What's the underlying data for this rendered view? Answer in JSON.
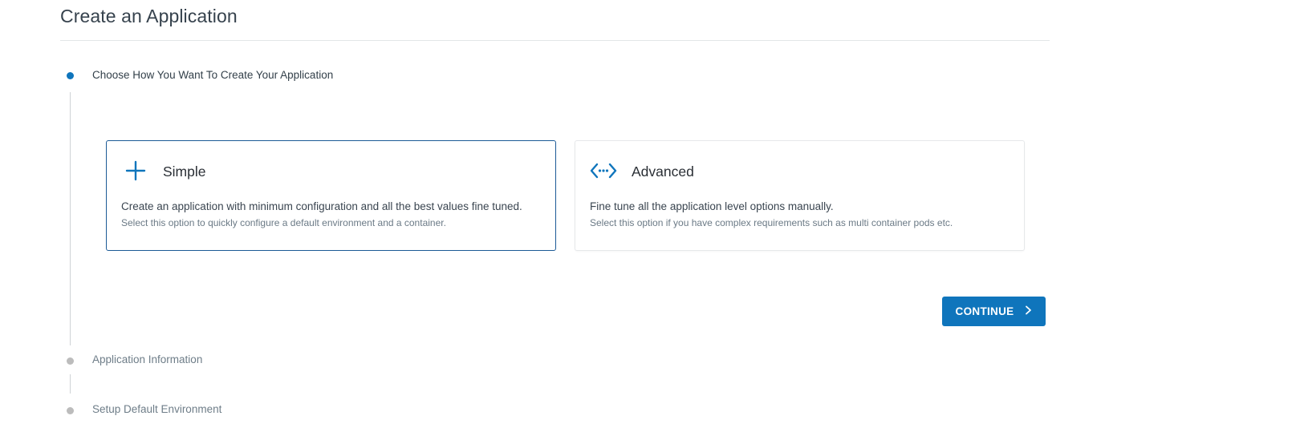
{
  "page": {
    "title": "Create an Application"
  },
  "stepper": {
    "steps": [
      {
        "label": "Choose How You Want To Create Your Application",
        "state": "active"
      },
      {
        "label": "Application Information",
        "state": "inactive"
      },
      {
        "label": "Setup Default Environment",
        "state": "inactive"
      }
    ]
  },
  "options": {
    "simple": {
      "icon": "plus-icon",
      "title": "Simple",
      "description": "Create an application with minimum configuration and all the best values fine tuned.",
      "subtext": "Select this option to quickly configure a default environment and a container.",
      "selected": true
    },
    "advanced": {
      "icon": "code-brackets-icon",
      "title": "Advanced",
      "description": "Fine tune all the application level options manually.",
      "subtext": "Select this option if you have complex requirements such as multi container pods etc.",
      "selected": false
    }
  },
  "actions": {
    "continue_label": "CONTINUE",
    "continue_icon": "chevron-right-icon"
  },
  "colors": {
    "accent": "#0f75bc",
    "selected_border": "#1c5a96",
    "inactive_dot": "#bcbcbc"
  }
}
